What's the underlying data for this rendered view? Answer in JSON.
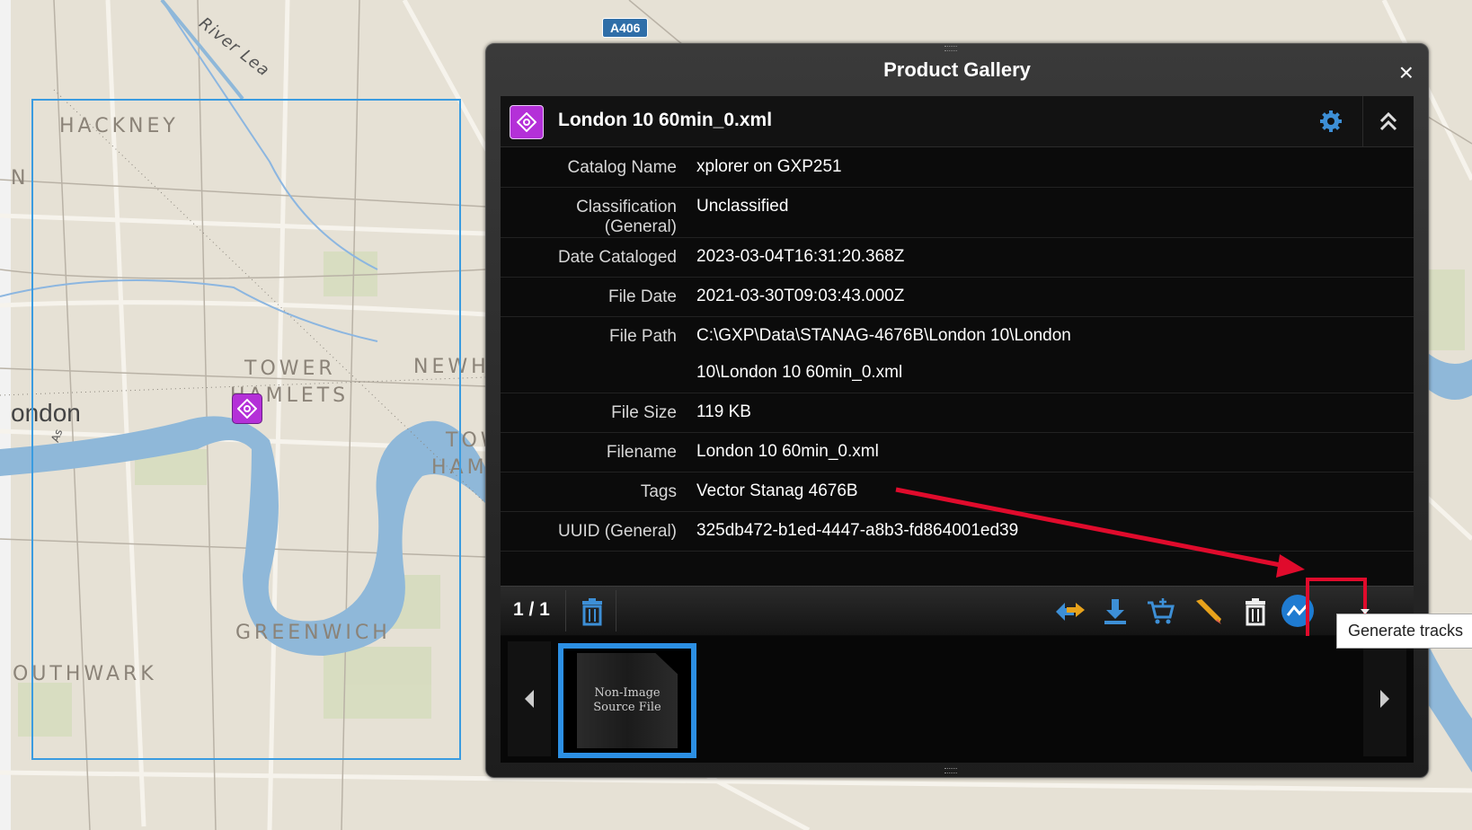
{
  "map": {
    "labels": {
      "hackney": "HACKNEY",
      "tower_hamlets_1": "TOWER",
      "tower_hamlets_2": "HAMLETS",
      "newham": "NEWHA",
      "tower_hamlets_r1": "TOW",
      "tower_hamlets_r2": "HAM",
      "london": "ondon",
      "greenwich": "GREENWICH",
      "southwark": "OUTHWARK",
      "river_lea": "River Lea",
      "edge_n": "N",
      "as": "As"
    },
    "road_shield": "A406"
  },
  "gallery": {
    "title": "Product Gallery",
    "close": "×",
    "product": {
      "title": "London 10 60min_0.xml",
      "fields": [
        {
          "label": "Catalog Name",
          "value": "xplorer on GXP251"
        },
        {
          "label": "Classification (General)",
          "value": "Unclassified"
        },
        {
          "label": "Date Cataloged",
          "value": "2023-03-04T16:31:20.368Z"
        },
        {
          "label": "File Date",
          "value": "2021-03-30T09:03:43.000Z"
        },
        {
          "label": "File Path",
          "value": "C:\\GXP\\Data\\STANAG-4676B\\London 10\\London 10\\London 10 60min_0.xml"
        },
        {
          "label": "File Size",
          "value": "119 KB"
        },
        {
          "label": "Filename",
          "value": "London 10 60min_0.xml"
        },
        {
          "label": "Tags",
          "value": "Vector Stanag 4676B"
        },
        {
          "label": "UUID (General)",
          "value": "325db472-b1ed-4447-a8b3-fd864001ed39"
        }
      ]
    },
    "toolbar": {
      "counter": "1 / 1",
      "icons": [
        "trash-icon",
        "swap-arrows-icon",
        "download-icon",
        "cart-icon",
        "pencil-icon",
        "delete-icon",
        "generate-tracks-icon",
        "caret-down-icon"
      ]
    },
    "thumbnail": {
      "line1": "Non-Image",
      "line2": "Source File"
    },
    "tooltip": "Generate tracks"
  },
  "colors": {
    "accent": "#2c8fe3",
    "product": "#b430d8",
    "highlight": "#e00b2c"
  }
}
